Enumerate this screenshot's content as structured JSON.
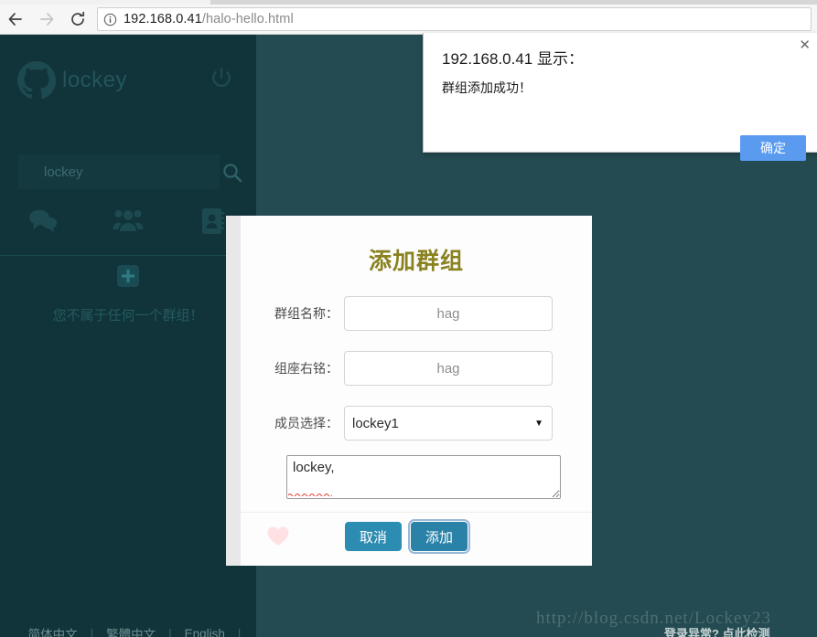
{
  "browser": {
    "back_icon": "back-arrow-icon",
    "forward_icon": "forward-arrow-icon",
    "reload_icon": "reload-icon",
    "info_icon": "page-info-icon",
    "url_host": "192.168.0.41",
    "url_path": "/halo-hello.html"
  },
  "dialog": {
    "title": "192.168.0.41 显示：",
    "message": "群组添加成功！",
    "ok_label": "确定",
    "close_label": "✕",
    "ok_color": "#5a9bf0"
  },
  "sidebar": {
    "logo_icon": "github-logo-icon",
    "brand": "lockey",
    "power_icon": "power-icon",
    "search": {
      "value": "lockey",
      "placeholder": "lockey",
      "icon": "search-icon"
    },
    "nav_icons": [
      {
        "name": "comments-icon",
        "label": "消息"
      },
      {
        "name": "group-icon",
        "label": "群组"
      },
      {
        "name": "contacts-icon",
        "label": "通讯录"
      }
    ],
    "add_group_icon": "plus-square-icon",
    "empty_message": "您不属于任何一个群组！",
    "languages": [
      {
        "label": "简体中文"
      },
      {
        "label": "繁體中文"
      },
      {
        "label": "English"
      }
    ],
    "lang_separator": "|",
    "bg_color": "#103439"
  },
  "page": {
    "bg_color": "#244b51",
    "login_help": "登录异常? 点此检测",
    "watermark": "http://blog.csdn.net/Lockey23"
  },
  "modal": {
    "title": "添加群组",
    "title_color": "#8a8220",
    "fields": [
      {
        "label": "群组名称：",
        "value": "hag",
        "name": "group-name"
      },
      {
        "label": "组座右铭：",
        "value": "hag",
        "name": "group-motto"
      }
    ],
    "select": {
      "label": "成员选择：",
      "value": "lockey1",
      "options": [
        "lockey1"
      ],
      "arrow": "▼"
    },
    "textarea": {
      "value": "lockey,"
    },
    "heart_icon": "heart-icon",
    "heart_color": "#ffe1e4",
    "cancel_label": "取消",
    "add_label": "添加",
    "button_color": "#2d8cb2"
  }
}
